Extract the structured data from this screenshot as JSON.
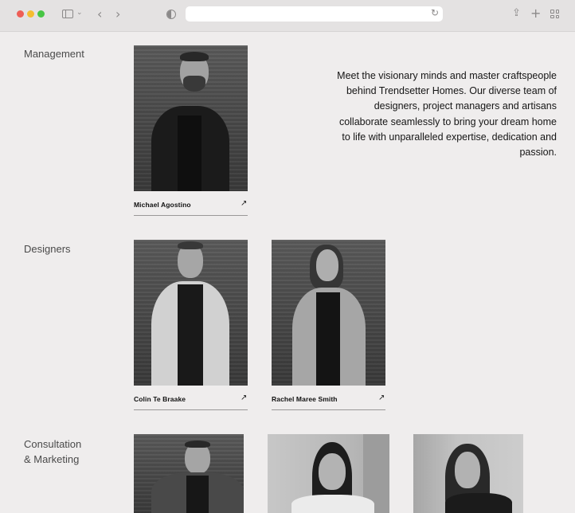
{
  "browser": {
    "url": "",
    "icons": [
      "sidebar-icon",
      "chevron-down-icon",
      "back-icon",
      "forward-icon",
      "privacy-shield-icon",
      "reload-icon",
      "share-icon",
      "new-tab-icon",
      "tab-overview-icon"
    ]
  },
  "sections": {
    "management": {
      "label": "Management"
    },
    "designers": {
      "label": "Designers"
    },
    "consultation": {
      "label_line1": "Consultation",
      "label_line2": "& Marketing"
    }
  },
  "intro": "Meet the visionary minds and master craftspeople behind Trendsetter Homes. Our diverse team of designers, project managers and artisans collaborate seamlessly to bring your dream home to life with unparalleled expertise, dedication and passion.",
  "team": {
    "michael": {
      "name": "Michael Agostino",
      "arrow": "↗"
    },
    "colin": {
      "name": "Colin Te Braake",
      "arrow": "↗"
    },
    "rachel": {
      "name": "Rachel Maree Smith",
      "arrow": "↗"
    }
  }
}
